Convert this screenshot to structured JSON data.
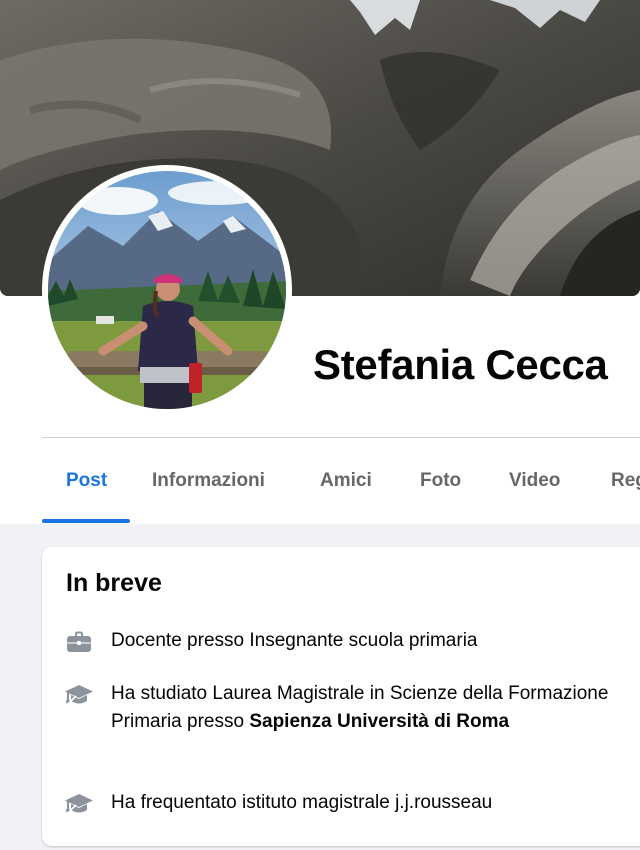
{
  "profile": {
    "name": "Stefania Cecca"
  },
  "tabs": [
    {
      "label": "Post",
      "active": true
    },
    {
      "label": "Informazioni",
      "active": false
    },
    {
      "label": "Amici",
      "active": false
    },
    {
      "label": "Foto",
      "active": false
    },
    {
      "label": "Video",
      "active": false
    },
    {
      "label": "Reg",
      "active": false
    }
  ],
  "intro": {
    "title": "In breve",
    "items": [
      {
        "icon": "briefcase-icon",
        "text": "Docente presso Insegnante scuola primaria"
      },
      {
        "icon": "graduation-cap-icon",
        "text": "Ha studiato Laurea Magistrale in Scienze della Formazione Primaria presso ",
        "link": "Sapienza Università di Roma"
      },
      {
        "icon": "graduation-cap-icon",
        "text": "Ha frequentato istituto magistrale j.j.rousseau"
      }
    ]
  },
  "colors": {
    "accent": "#1b74e4",
    "secondary_text": "#65676b",
    "background": "#f0f2f5"
  }
}
